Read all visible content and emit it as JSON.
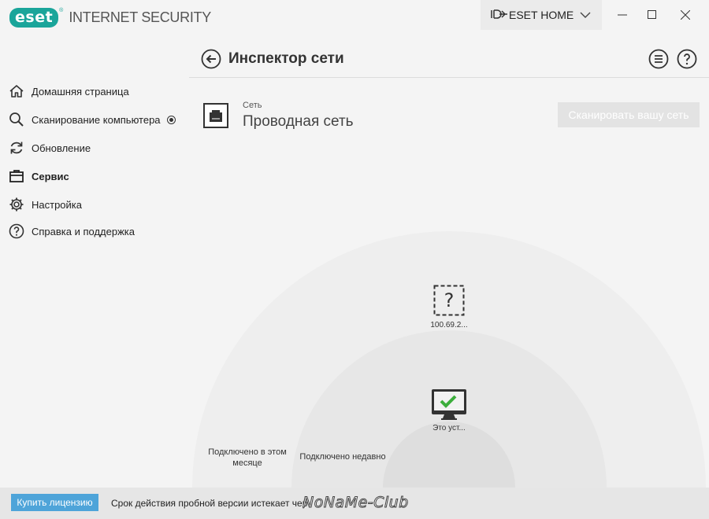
{
  "app": {
    "logo_text": "eset",
    "logo_reg": "®",
    "product_name": "INTERNET SECURITY",
    "home_label": "ESET HOME",
    "accent_color": "#1aa59a"
  },
  "sidebar": {
    "items": [
      {
        "label": "Домашняя страница",
        "icon": "home-icon"
      },
      {
        "label": "Сканирование компьютера",
        "icon": "search-icon"
      },
      {
        "label": "Обновление",
        "icon": "refresh-icon"
      },
      {
        "label": "Сервис",
        "icon": "toolbox-icon",
        "active": true
      },
      {
        "label": "Настройка",
        "icon": "gear-icon"
      },
      {
        "label": "Справка и поддержка",
        "icon": "help-icon"
      }
    ]
  },
  "header": {
    "title": "Инспектор сети"
  },
  "network": {
    "label": "Сеть",
    "name": "Проводная сеть",
    "scan_button": "Сканировать вашу сеть"
  },
  "devices": [
    {
      "label": "100.69.2...",
      "icon": "unknown-device-icon"
    },
    {
      "label": "Это уст...",
      "icon": "computer-ok-icon"
    }
  ],
  "zones": {
    "month_line1": "Подключено в этом",
    "month_line2": "месяце",
    "recent": "Подключено недавно"
  },
  "footer": {
    "buy_button": "Купить лицензию",
    "trial_text": "Срок действия пробной версии истекает чер",
    "watermark": "NoNaMe-Club",
    "button_color": "#4ea4d9"
  }
}
